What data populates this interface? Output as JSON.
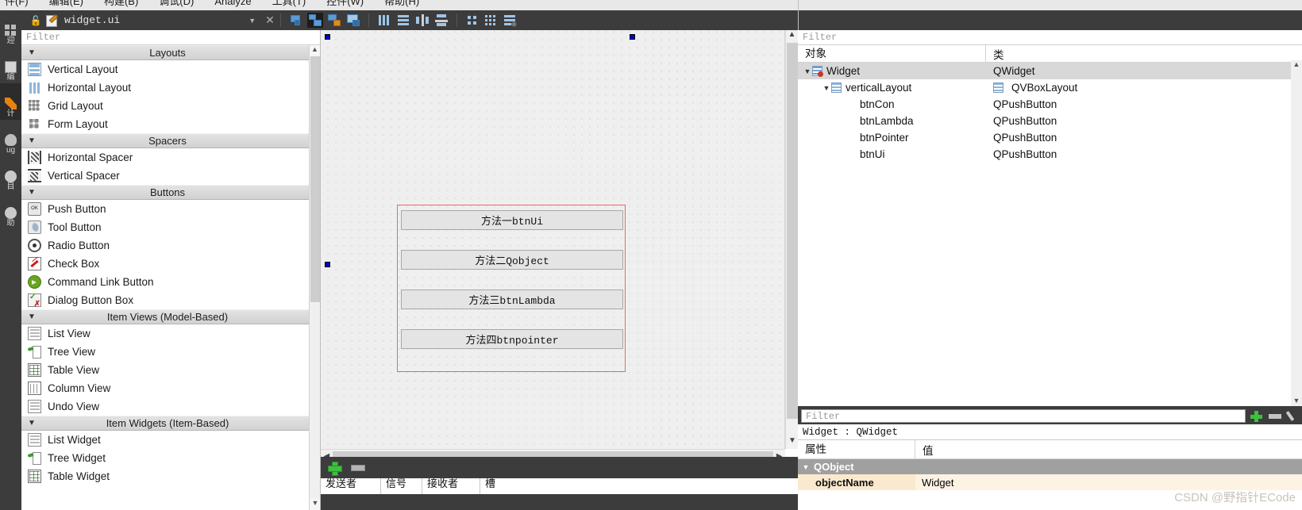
{
  "menubar": {
    "items": [
      "件(F)",
      "编辑(E)",
      "构建(B)",
      "调试(D)",
      "Analyze",
      "工具(T)",
      "控件(W)",
      "帮助(H)"
    ]
  },
  "modes": [
    {
      "label": "迎",
      "icon": "welcome-icon"
    },
    {
      "label": "编",
      "icon": "edit-icon"
    },
    {
      "label": "计",
      "icon": "design-icon"
    },
    {
      "label": "ug",
      "icon": "debug-icon"
    },
    {
      "label": "目",
      "icon": "project-icon"
    },
    {
      "label": "助",
      "icon": "help-icon"
    }
  ],
  "editor_tab": {
    "filename": "widget.ui",
    "lock_icon": "unlock-icon",
    "file_icon": "ui-file-icon",
    "dropdown_icon": "chevron-down-icon",
    "close_icon": "close-icon"
  },
  "toolbar": {
    "buttons": [
      "edit-widgets-icon",
      "edit-signals-slots-icon",
      "edit-buddies-icon",
      "edit-tab-order-icon",
      "layout-horizontally-icon",
      "layout-vertically-icon",
      "layout-splitter-horizontal-icon",
      "layout-splitter-vertical-icon",
      "layout-form-icon",
      "layout-grid-icon",
      "break-layout-icon"
    ],
    "selected_index": 1
  },
  "widget_box": {
    "filter_placeholder": "Filter",
    "categories": [
      {
        "title": "Layouts",
        "expanded": true,
        "items": [
          {
            "label": "Vertical Layout",
            "icon": "vertical-layout-icon"
          },
          {
            "label": "Horizontal Layout",
            "icon": "horizontal-layout-icon"
          },
          {
            "label": "Grid Layout",
            "icon": "grid-layout-icon"
          },
          {
            "label": "Form Layout",
            "icon": "form-layout-icon"
          }
        ]
      },
      {
        "title": "Spacers",
        "expanded": true,
        "items": [
          {
            "label": "Horizontal Spacer",
            "icon": "horizontal-spacer-icon"
          },
          {
            "label": "Vertical Spacer",
            "icon": "vertical-spacer-icon"
          }
        ]
      },
      {
        "title": "Buttons",
        "expanded": true,
        "items": [
          {
            "label": "Push Button",
            "icon": "push-button-icon"
          },
          {
            "label": "Tool Button",
            "icon": "tool-button-icon"
          },
          {
            "label": "Radio Button",
            "icon": "radio-button-icon"
          },
          {
            "label": "Check Box",
            "icon": "check-box-icon"
          },
          {
            "label": "Command Link Button",
            "icon": "command-link-button-icon"
          },
          {
            "label": "Dialog Button Box",
            "icon": "dialog-button-box-icon"
          }
        ]
      },
      {
        "title": "Item Views (Model-Based)",
        "expanded": true,
        "items": [
          {
            "label": "List View",
            "icon": "list-view-icon"
          },
          {
            "label": "Tree View",
            "icon": "tree-view-icon"
          },
          {
            "label": "Table View",
            "icon": "table-view-icon"
          },
          {
            "label": "Column View",
            "icon": "column-view-icon"
          },
          {
            "label": "Undo View",
            "icon": "undo-view-icon"
          }
        ]
      },
      {
        "title": "Item Widgets (Item-Based)",
        "expanded": true,
        "items": [
          {
            "label": "List Widget",
            "icon": "list-widget-icon"
          },
          {
            "label": "Tree Widget",
            "icon": "tree-widget-icon"
          },
          {
            "label": "Table Widget",
            "icon": "table-widget-icon"
          }
        ]
      }
    ]
  },
  "canvas": {
    "form_buttons": [
      "方法一btnUi",
      "方法二Qobject",
      "方法三btnLambda",
      "方法四btnpointer"
    ],
    "selection_color": "#0000cc",
    "form_border_color": "#e26a6a"
  },
  "signal_slot_editor": {
    "add_icon": "plus-icon",
    "remove_icon": "minus-icon",
    "columns": [
      "发送者",
      "信号",
      "接收者",
      "槽"
    ]
  },
  "object_inspector": {
    "filter_placeholder": "Filter",
    "columns": [
      "对象",
      "类"
    ],
    "rows": [
      {
        "name": "Widget",
        "class": "QWidget",
        "depth": 0,
        "expanded": true,
        "icon": "widget-icon",
        "class_icon": "",
        "selected": true
      },
      {
        "name": "verticalLayout",
        "class": "QVBoxLayout",
        "depth": 1,
        "expanded": true,
        "icon": "vbox-layout-icon",
        "class_icon": "vbox-layout-icon",
        "selected": false
      },
      {
        "name": "btnCon",
        "class": "QPushButton",
        "depth": 2,
        "expanded": null,
        "icon": "",
        "class_icon": "",
        "selected": false
      },
      {
        "name": "btnLambda",
        "class": "QPushButton",
        "depth": 2,
        "expanded": null,
        "icon": "",
        "class_icon": "",
        "selected": false
      },
      {
        "name": "btnPointer",
        "class": "QPushButton",
        "depth": 2,
        "expanded": null,
        "icon": "",
        "class_icon": "",
        "selected": false
      },
      {
        "name": "btnUi",
        "class": "QPushButton",
        "depth": 2,
        "expanded": null,
        "icon": "",
        "class_icon": "",
        "selected": false
      }
    ]
  },
  "property_editor": {
    "filter_placeholder": "Filter",
    "add_icon": "plus-icon",
    "remove_icon": "minus-icon",
    "configure_icon": "wrench-icon",
    "object_line": "Widget : QWidget",
    "columns": [
      "属性",
      "值"
    ],
    "groups": [
      {
        "name": "QObject",
        "expanded": true,
        "properties": [
          {
            "key": "objectName",
            "value": "Widget"
          }
        ]
      }
    ]
  },
  "watermark": {
    "text": "CSDN @野指针ECode"
  }
}
